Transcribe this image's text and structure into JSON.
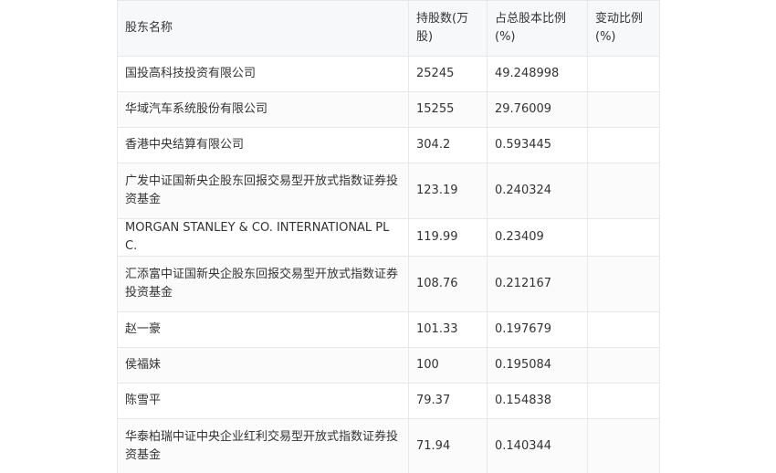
{
  "table": {
    "headers": [
      "股东名称",
      "持股数(万股)",
      "占总股本比例(%)",
      "变动比例(%)"
    ],
    "rows": [
      [
        "国投高科技投资有限公司",
        "25245",
        "49.248998",
        ""
      ],
      [
        "华域汽车系统股份有限公司",
        "15255",
        "29.76009",
        ""
      ],
      [
        "香港中央结算有限公司",
        "304.2",
        "0.593445",
        ""
      ],
      [
        "广发中证国新央企股东回报交易型开放式指数证券投资基金",
        "123.19",
        "0.240324",
        ""
      ],
      [
        "MORGAN STANLEY & CO. INTERNATIONAL PLC.",
        "119.99",
        "0.23409",
        ""
      ],
      [
        "汇添富中证国新央企股东回报交易型开放式指数证券投资基金",
        "108.76",
        "0.212167",
        ""
      ],
      [
        "赵一豪",
        "101.33",
        "0.197679",
        ""
      ],
      [
        "侯福妹",
        "100",
        "0.195084",
        ""
      ],
      [
        "陈雪平",
        "79.37",
        "0.154838",
        ""
      ],
      [
        "华泰柏瑞中证中央企业红利交易型开放式指数证券投资基金",
        "71.94",
        "0.140344",
        ""
      ]
    ]
  }
}
